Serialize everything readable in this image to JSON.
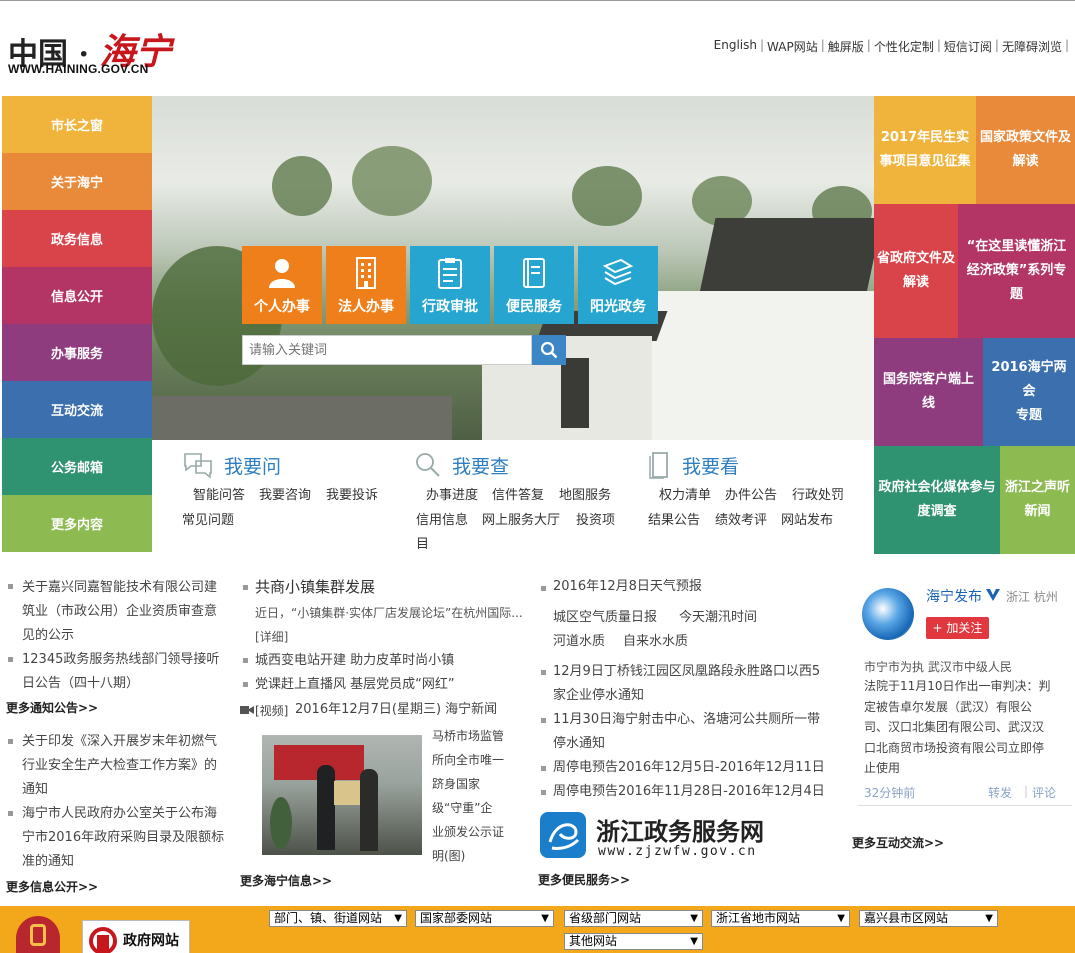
{
  "header": {
    "logo_cn": "中国 · ",
    "logo_hn": "海宁",
    "logo_url": "WWW.HAINING.GOV.CN",
    "links": [
      "English",
      "WAP网站",
      "触屏版",
      "个性化定制",
      "短信订阅",
      "无障碍浏览"
    ]
  },
  "left_nav": [
    {
      "label": "市长之窗",
      "color": "#f0b33c"
    },
    {
      "label": "关于海宁",
      "color": "#e98a3a"
    },
    {
      "label": "政务信息",
      "color": "#d9434a"
    },
    {
      "label": "信息公开",
      "color": "#b23565"
    },
    {
      "label": "办事服务",
      "color": "#8e3c7e"
    },
    {
      "label": "互动交流",
      "color": "#3b6fae"
    },
    {
      "label": "公务邮箱",
      "color": "#2f9271"
    },
    {
      "label": "更多内容",
      "color": "#8dbb52"
    }
  ],
  "services": [
    {
      "label": "个人办事",
      "color": "#ef7f1a"
    },
    {
      "label": "法人办事",
      "color": "#ef7f1a"
    },
    {
      "label": "行政审批",
      "color": "#25a5cf"
    },
    {
      "label": "便民服务",
      "color": "#25a5cf"
    },
    {
      "label": "阳光政务",
      "color": "#25a5cf"
    }
  ],
  "search": {
    "placeholder": "请输入关键词"
  },
  "quick": {
    "ask": {
      "title": "我要问",
      "links": [
        "智能问答",
        "我要咨询",
        "我要投诉",
        "常见问题"
      ]
    },
    "check": {
      "title": "我要查",
      "links": [
        "办事进度",
        "信件答复",
        "地图服务",
        "信用信息",
        "网上服务大厅",
        "投资项",
        "目"
      ]
    },
    "see": {
      "title": "我要看",
      "links": [
        "权力清单",
        "办件公告",
        "行政处罚",
        "结果公告",
        "绩效考评",
        "网站发布"
      ]
    }
  },
  "tiles": [
    {
      "lines": [
        "2017年民生实",
        "事项目意见征集"
      ],
      "color": "#f0b33c"
    },
    {
      "lines": [
        "国家政策文件及",
        "解读"
      ],
      "color": "#e98a3a"
    },
    {
      "lines": [
        "省政府文件及",
        "解读"
      ],
      "color": "#d9434a"
    },
    {
      "lines": [
        "“在这里读懂浙江",
        "经济政策”系列专",
        "题"
      ],
      "color": "#b23565"
    },
    {
      "lines": [
        "国务院客户端上",
        "线"
      ],
      "color": "#8e3c7e"
    },
    {
      "lines": [
        "2016海宁两会",
        "专题"
      ],
      "color": "#3b6fae"
    },
    {
      "lines": [
        "政府社会化媒体参与",
        "度调查"
      ],
      "color": "#2f9271"
    },
    {
      "lines": [
        "浙江之声听",
        "新闻"
      ],
      "color": "#8dbb52"
    }
  ],
  "col1": {
    "notices": [
      [
        "关于嘉兴同嘉智能技术有限公司建",
        "筑业（市政公用）企业资质审查意",
        "见的公示"
      ],
      [
        "12345政务服务热线部门领导接听",
        "日公告（四十八期）"
      ]
    ],
    "more_notices": "更多通知公告>>",
    "info": [
      [
        "关于印发《深入开展岁末年初燃气",
        "行业安全生产大检查工作方案》的",
        "通知"
      ],
      [
        "海宁市人民政府办公室关于公布海",
        "宁市2016年政府采购目录及限额标",
        "准的通知"
      ]
    ],
    "more_info": "更多信息公开>>"
  },
  "col2": {
    "headline": "共商小镇集群发展",
    "summary": "近日，“小镇集群·实体厂店发展论坛”在杭州国际...",
    "detail": "[详细]",
    "items": [
      "城西变电站开建 助力皮革时尚小镇",
      "党课赶上直播风 基层党员成“网红”"
    ],
    "video_tag": "[视频]",
    "video": "2016年12月7日(星期三) 海宁新闻",
    "photo_caption": [
      "马桥市场监管",
      "所向全市唯一",
      "跻身国家",
      "级“守重”企",
      "业颁发公示证",
      "明(图)"
    ],
    "more": "更多海宁信息>>"
  },
  "col3": {
    "weather": "2016年12月8日天气预报",
    "links_row1": [
      "城区空气质量日报",
      "今天潮汛时间"
    ],
    "links_row2": [
      "河道水质",
      "自来水水质"
    ],
    "items": [
      [
        "12月9日丁桥钱江园区凤凰路段永胜路口以西5",
        "家企业停水通知"
      ],
      [
        "11月30日海宁射击中心、洛塘河公共厕所一带",
        "停水通知"
      ],
      [
        "周停电预告2016年12月5日-2016年12月11日"
      ],
      [
        "周停电预告2016年11月28日-2016年12月4日"
      ]
    ],
    "zjzwfw_name": "浙江政务服务网",
    "zjzwfw_url": "www.zjzwfw.gov.cn",
    "more": "更多便民服务>>"
  },
  "weibo": {
    "name": "海宁发布",
    "location": "浙江 杭州",
    "follow": "加关注",
    "post_clip": "市宁市为执    武汉市中级人民",
    "post": [
      "法院于11月10日作出一审判决：判",
      "定被告卓尔发展（武汉）有限公",
      "司、汉口北集团有限公司、武汉汉",
      "口北商贸市场投资有限公司立即停",
      "止使用"
    ],
    "time": "32分钟前",
    "repost": "转发",
    "comment": "评论",
    "more": "更多互动交流>>"
  },
  "footer": {
    "gov_site": "政府网站",
    "selects": [
      "部门、镇、街道网站",
      "国家部委网站",
      "省级部门网站",
      "浙江省地市网站",
      "嘉兴县市区网站",
      "其他网站"
    ]
  }
}
